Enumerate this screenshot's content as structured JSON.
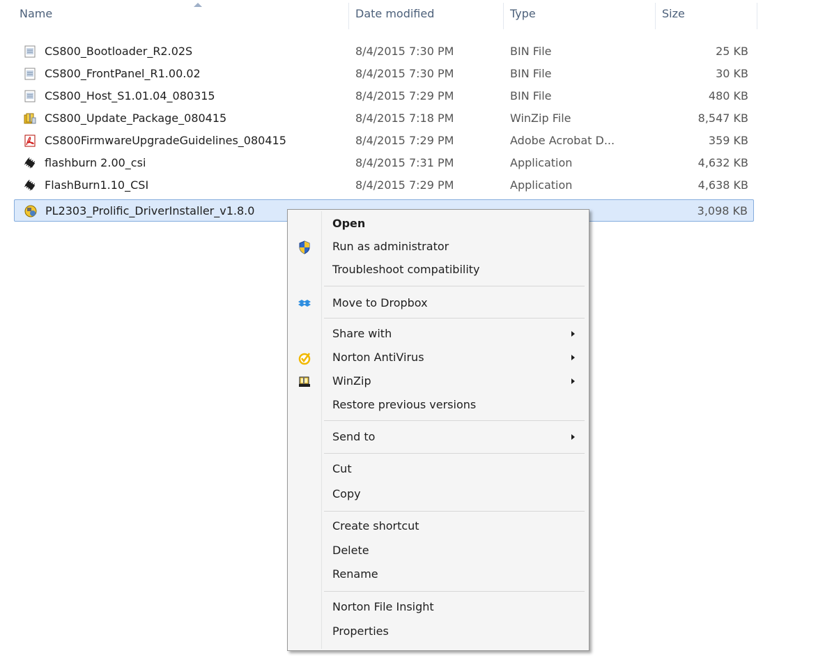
{
  "columns": {
    "name": "Name",
    "date": "Date modified",
    "type": "Type",
    "size": "Size"
  },
  "files": [
    {
      "name": "CS800_Bootloader_R2.02S",
      "date": "8/4/2015 7:30 PM",
      "type": "BIN File",
      "size": "25 KB",
      "icon": "bin-file-icon"
    },
    {
      "name": "CS800_FrontPanel_R1.00.02",
      "date": "8/4/2015 7:30 PM",
      "type": "BIN File",
      "size": "30 KB",
      "icon": "bin-file-icon"
    },
    {
      "name": "CS800_Host_S1.01.04_080315",
      "date": "8/4/2015 7:29 PM",
      "type": "BIN File",
      "size": "480 KB",
      "icon": "bin-file-icon"
    },
    {
      "name": "CS800_Update_Package_080415",
      "date": "8/4/2015 7:18 PM",
      "type": "WinZip File",
      "size": "8,547 KB",
      "icon": "winzip-file-icon"
    },
    {
      "name": "CS800FirmwareUpgradeGuidelines_080415",
      "date": "8/4/2015 7:29 PM",
      "type": "Adobe Acrobat D...",
      "size": "359 KB",
      "icon": "pdf-file-icon"
    },
    {
      "name": "flashburn 2.00_csi",
      "date": "8/4/2015 7:31 PM",
      "type": "Application",
      "size": "4,632 KB",
      "icon": "chip-app-icon"
    },
    {
      "name": "FlashBurn1.10_CSI",
      "date": "8/4/2015 7:29 PM",
      "type": "Application",
      "size": "4,638 KB",
      "icon": "chip-app-icon"
    },
    {
      "name": "PL2303_Prolific_DriverInstaller_v1.8.0",
      "date": "",
      "type": "",
      "size": "3,098 KB",
      "icon": "installer-icon",
      "selected": true
    }
  ],
  "context_menu": {
    "open": "Open",
    "run_as_admin": "Run as administrator",
    "troubleshoot": "Troubleshoot compatibility",
    "move_to_dropbox": "Move to Dropbox",
    "share_with": "Share with",
    "norton_antivirus": "Norton AntiVirus",
    "winzip": "WinZip",
    "restore_previous": "Restore previous versions",
    "send_to": "Send to",
    "cut": "Cut",
    "copy": "Copy",
    "create_shortcut": "Create shortcut",
    "delete": "Delete",
    "rename": "Rename",
    "norton_file_insight": "Norton File Insight",
    "properties": "Properties"
  }
}
